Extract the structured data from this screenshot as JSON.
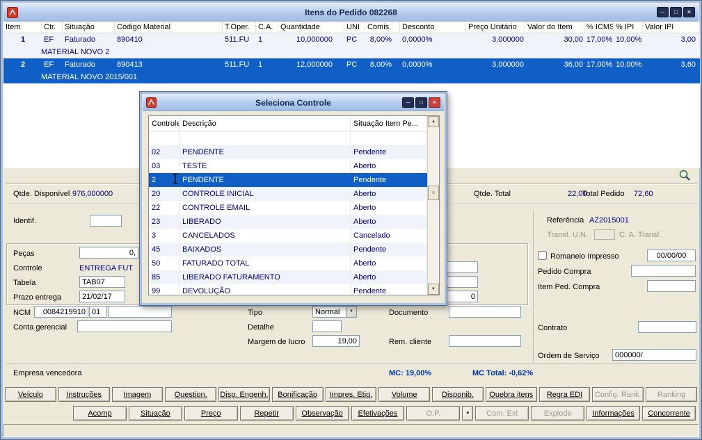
{
  "colors": {
    "selection": "#0F5FC6",
    "navy_text": "#000080",
    "mc_text": "#0033A6",
    "titlebar": "#B4CBEC"
  },
  "icons": {
    "minimize": "─",
    "maximize": "□",
    "close": "✕",
    "dropdown": "▼",
    "scroll_up": "▲",
    "scroll_down": "▼",
    "thumb_grip": "≡"
  },
  "window": {
    "title": "Itens do Pedido 082268"
  },
  "grid": {
    "columns": [
      "Item",
      "Ctr.",
      "Situação",
      "Código Material",
      "T.Oper.",
      "C.A.",
      "Quantidade",
      "UNI",
      "Comis.",
      "Desconto",
      "Preço Unitário",
      "Valor do Item",
      "% ICMS",
      "% IPI",
      "Valor IPI"
    ],
    "rows": [
      {
        "item": "1",
        "ctr": "EF",
        "situacao": "Faturado",
        "codigo": "890410",
        "toper": "511.FU",
        "ca": "1",
        "quantidade": "10,000000",
        "uni": "PC",
        "comis": "8,00%",
        "desconto": "0,0000%",
        "preco_unitario": "3,000000",
        "valor_item": "30,00",
        "perc_icms": "17,00%",
        "perc_ipi": "10,00%",
        "valor_ipi": "3,00",
        "descricao": "MATERIAL NOVO 2"
      },
      {
        "item": "2",
        "ctr": "EF",
        "situacao": "Faturado",
        "codigo": "890413",
        "toper": "511.FU",
        "ca": "1",
        "quantidade": "12,000000",
        "uni": "PC",
        "comis": "8,00%",
        "desconto": "0,0000%",
        "preco_unitario": "3,000000",
        "valor_item": "36,00",
        "perc_icms": "17,00%",
        "perc_ipi": "10,00%",
        "valor_ipi": "3,60",
        "descricao": "MATERIAL NOVO 2015/001"
      }
    ]
  },
  "summary": {
    "qtde_disponivel_label": "Qtde. Disponível",
    "qtde_disponivel": "976,000000",
    "qtde_total_label": "Qtde. Total",
    "qtde_total": "22,00",
    "total_pedido_label": "Total Pedido",
    "total_pedido": "72,60"
  },
  "form": {
    "identif_label": "Identif.",
    "identif_value": "",
    "referencia_label": "Referência",
    "referencia_value": "AZ2015001",
    "transf_un_label": "Transf. U.N.",
    "transf_un_value": "",
    "ca_transf_label": "C. A. Transf.",
    "pecas_label": "Peças",
    "pecas_value": "0,",
    "controle_label": "Controle",
    "controle_value": "ENTREGA FUT",
    "tabela_label": "Tabela",
    "tabela_value": "TAB07",
    "prazo_label": "Prazo entrega",
    "prazo_value": "21/02/17",
    "ncm_label": "NCM",
    "ncm_value": "0084219910",
    "ncm_ext_value": "01",
    "ncm_extra_value": "",
    "conta_label": "Conta gerencial",
    "conta_value": "",
    "tipo_label": "Tipo",
    "tipo_value": "Normal",
    "detalhe_label": "Detalhe",
    "detalhe_value": "",
    "margem_label": "Margem de lucro",
    "margem_value": "19,00",
    "documento_label": "Documento",
    "documento_value": "",
    "rem_cliente_label": "Rem. cliente",
    "rem_cliente_value": "",
    "hidden_field_1": "",
    "hidden_field_2": "",
    "hidden_field_3": "0",
    "romaneio_label": "Romaneio Impresso",
    "romaneio_checked": false,
    "romaneio_date": "00/00/00",
    "pedido_compra_label": "Pedido Compra",
    "pedido_compra_value": "",
    "item_ped_label": "Item Ped. Compra",
    "item_ped_value": "",
    "contrato_label": "Contrato",
    "contrato_value": "",
    "ordem_label": "Ordem de Serviço",
    "ordem_value": "000000/",
    "empresa_label": "Empresa vencedora",
    "mc_value": "MC: 19,00%",
    "mc_total_value": "MC Total: -0,62%"
  },
  "buttons_row1": [
    {
      "label": "Veículo",
      "enabled": true
    },
    {
      "label": "Instruções",
      "enabled": true
    },
    {
      "label": "Imagem",
      "enabled": true
    },
    {
      "label": "Question.",
      "enabled": true
    },
    {
      "label": "Disp. Engenh.",
      "enabled": true
    },
    {
      "label": "Bonificação",
      "enabled": true
    },
    {
      "label": "Impres. Etiq.",
      "enabled": true
    },
    {
      "label": "Volume",
      "enabled": true
    },
    {
      "label": "Disponib.",
      "enabled": true
    },
    {
      "label": "Quebra itens",
      "enabled": true
    },
    {
      "label": "Regra EDI",
      "enabled": true
    },
    {
      "label": "Config. Rank.",
      "enabled": false
    },
    {
      "label": "Ranking",
      "enabled": false
    }
  ],
  "buttons_row2": [
    {
      "label": "Acomp",
      "enabled": true
    },
    {
      "label": "Situação",
      "enabled": true
    },
    {
      "label": "Preço",
      "enabled": true
    },
    {
      "label": "Repetir",
      "enabled": true
    },
    {
      "label": "Observação",
      "enabled": true
    },
    {
      "label": "Efetivações",
      "enabled": true
    },
    {
      "label": "O.P.",
      "enabled": false
    },
    {
      "label": "Com. Ext",
      "enabled": false
    },
    {
      "label": "Explode",
      "enabled": false
    },
    {
      "label": "Informações",
      "enabled": true
    },
    {
      "label": "Concorrente",
      "enabled": true
    }
  ],
  "dialog": {
    "title": "Seleciona Controle",
    "columns": [
      "Controle",
      "Descrição",
      "Situação Item Pe..."
    ],
    "selected_index": 3,
    "rows": [
      {
        "controle": "",
        "descricao": "",
        "situacao": ""
      },
      {
        "controle": "02",
        "descricao": "PENDENTE",
        "situacao": "Pendente"
      },
      {
        "controle": "03",
        "descricao": "TESTE",
        "situacao": "Aberto"
      },
      {
        "controle": "2",
        "descricao": "PENDENTE",
        "situacao": "Pendente"
      },
      {
        "controle": "20",
        "descricao": "CONTROLE INICIAL",
        "situacao": "Aberto"
      },
      {
        "controle": "22",
        "descricao": "CONTROLE EMAIL",
        "situacao": "Aberto"
      },
      {
        "controle": "23",
        "descricao": "LIBERADO",
        "situacao": "Aberto"
      },
      {
        "controle": "3",
        "descricao": "CANCELADOS",
        "situacao": "Cancelado"
      },
      {
        "controle": "45",
        "descricao": "BAIXADOS",
        "situacao": "Pendente"
      },
      {
        "controle": "50",
        "descricao": "FATURADO TOTAL",
        "situacao": "Aberto"
      },
      {
        "controle": "85",
        "descricao": "LIBERADO FATURAMENTO",
        "situacao": "Aberto"
      },
      {
        "controle": "99",
        "descricao": "DEVOLUÇÃO",
        "situacao": "Pendente"
      }
    ]
  }
}
